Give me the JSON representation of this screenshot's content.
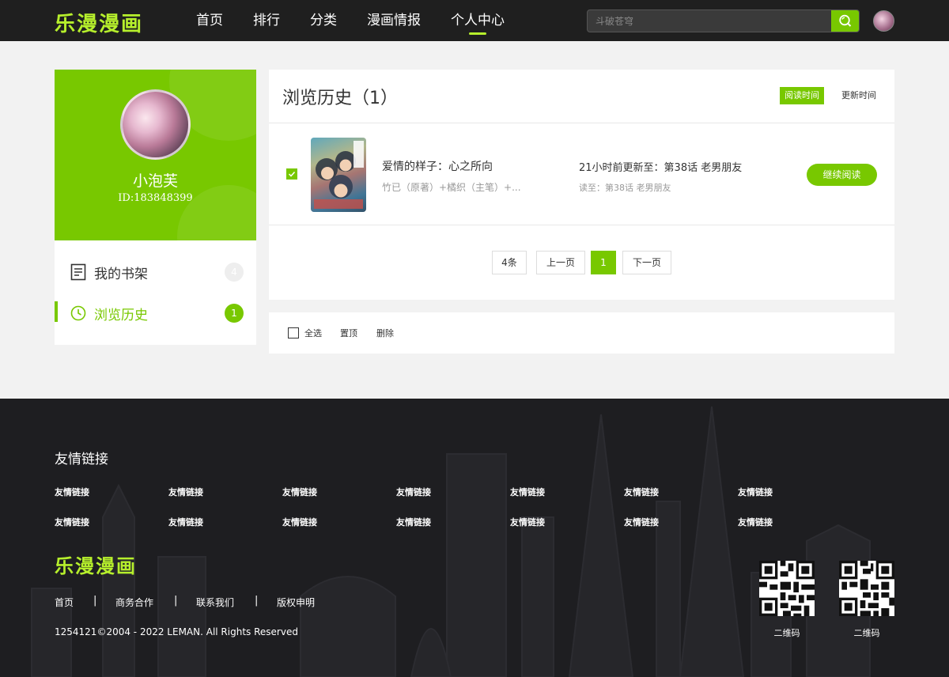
{
  "header": {
    "logo": "乐漫漫画",
    "nav": [
      "首页",
      "排行",
      "分类",
      "漫画情报",
      "个人中心"
    ],
    "nav_active_index": 4,
    "search_placeholder": "斗破苍穹",
    "search_icon": "search-icon"
  },
  "profile": {
    "name": "小泡芙",
    "id": "ID:183848399"
  },
  "sidebar": {
    "items": [
      {
        "label": "我的书架",
        "count": "4",
        "icon": "bookshelf-icon"
      },
      {
        "label": "浏览历史",
        "count": "1",
        "icon": "clock-icon"
      }
    ],
    "active_index": 1
  },
  "history": {
    "title": "浏览历史（1）",
    "sort": {
      "read_time": "阅读时间",
      "update_time": "更新时间"
    },
    "items": [
      {
        "title": "爱情的样子：心之所向",
        "authors": "竹已（原著）+橘织（主笔）+...",
        "update": "21小时前更新至：第38话 老男朋友",
        "read": "读至：第38话 老男朋友",
        "continue_label": "继续阅读"
      }
    ],
    "pagination": {
      "total": "4条",
      "prev": "上一页",
      "current": "1",
      "next": "下一页"
    }
  },
  "actions": {
    "select_all": "全选",
    "pin": "置顶",
    "delete": "删除"
  },
  "footer": {
    "friends_title": "友情链接",
    "friend_links": [
      "友情链接",
      "友情链接",
      "友情链接",
      "友情链接",
      "友情链接",
      "友情链接",
      "友情链接",
      "友情链接",
      "友情链接",
      "友情链接",
      "友情链接",
      "友情链接",
      "友情链接",
      "友情链接"
    ],
    "logo": "乐漫漫画",
    "links": [
      "首页",
      "商务合作",
      "联系我们",
      "版权申明"
    ],
    "separator": "|",
    "copyright": "1254121©2004 - 2022 LEMAN. All Rights Reserved",
    "qr_labels": [
      "二维码",
      "二维码"
    ]
  },
  "colors": {
    "accent": "#78c800",
    "logo": "#b6ef2c",
    "header_bg": "#1f1f1f",
    "footer_bg": "#1e1e21"
  }
}
